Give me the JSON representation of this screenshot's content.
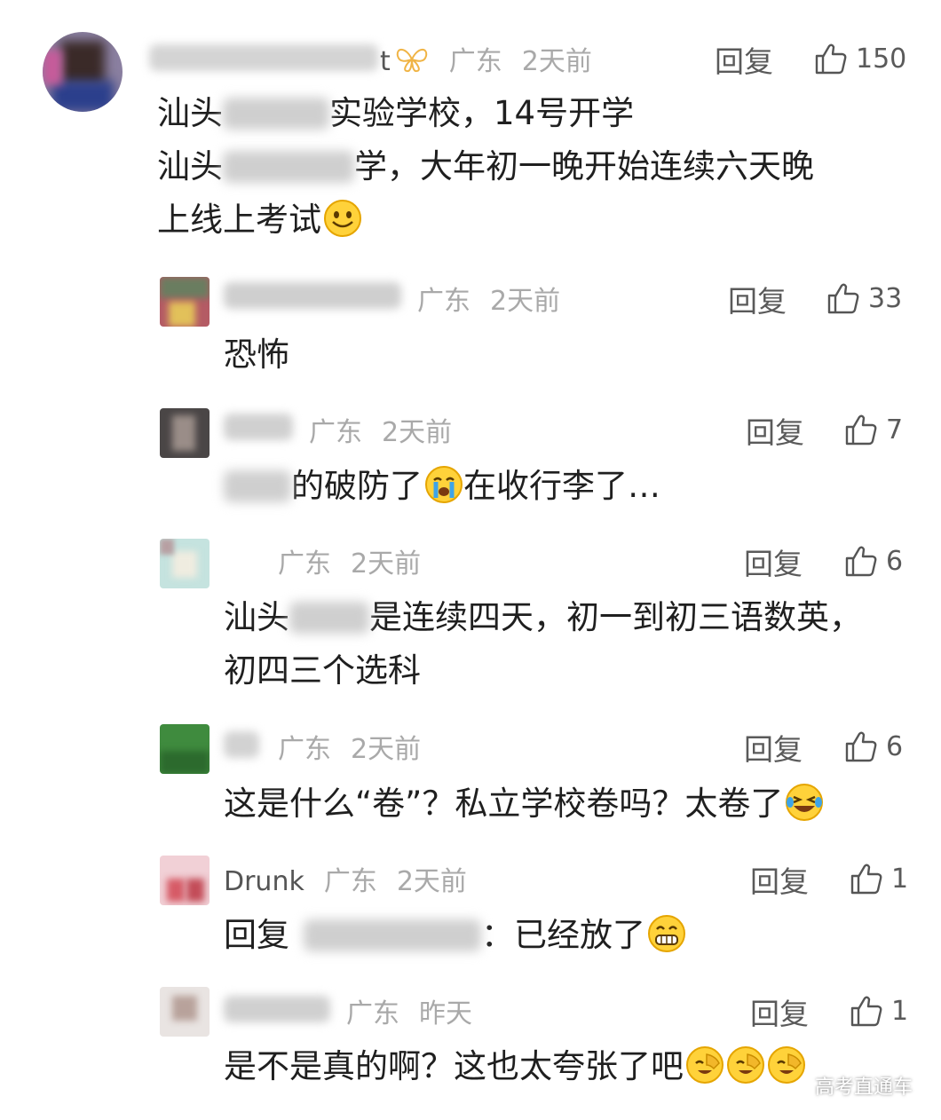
{
  "comments": [
    {
      "region": "广东",
      "time": "2天前",
      "reply": "回复",
      "likes": "150",
      "name_suffix": "t",
      "lines": [
        "汕头",
        "实验学校，14号开学",
        "汕头",
        "学，大年初一晚开始连续六天晚",
        "上线上考试"
      ]
    },
    {
      "region": "广东",
      "time": "2天前",
      "reply": "回复",
      "likes": "33",
      "text": "恐怖"
    },
    {
      "region": "广东",
      "time": "2天前",
      "reply": "回复",
      "likes": "7",
      "text": "的破防了",
      "text2": "在收行李了…"
    },
    {
      "region": "广东",
      "time": "2天前",
      "reply": "回复",
      "likes": "6",
      "line1a": "汕头",
      "line1b": "是连续四天，初一到初三语数英，",
      "line2": "初四三个选科"
    },
    {
      "region": "广东",
      "time": "2天前",
      "reply": "回复",
      "likes": "6",
      "text": "这是什么“卷”？私立学校卷吗？太卷了"
    },
    {
      "name": "Drunk",
      "region": "广东",
      "time": "2天前",
      "reply": "回复",
      "likes": "1",
      "prefix": "回复",
      "suffix": "：已经放了"
    },
    {
      "region": "广东",
      "time": "昨天",
      "reply": "回复",
      "likes": "1",
      "text": "是不是真的啊？这也太夸张了吧"
    }
  ],
  "watermark": "高考直通车",
  "icons": {
    "like": "thumbs-up-icon",
    "smile": "smile-emoji-icon",
    "cry": "crying-emoji-icon",
    "laugh": "laughing-tears-emoji-icon",
    "grin": "grin-emoji-icon",
    "facepalm": "facepalm-emoji-icon",
    "badge": "butterfly-badge-icon"
  },
  "colors": {
    "meta": "#a9a9a9",
    "text": "#1f1f1f",
    "action": "#5a5a5a"
  }
}
